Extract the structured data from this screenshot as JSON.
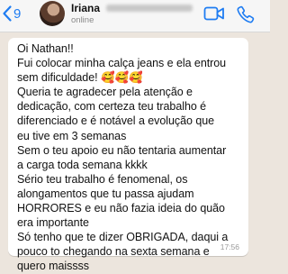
{
  "header": {
    "back_count": "9",
    "contact_name": "Iriana",
    "status": "online",
    "accent_color": "#1e7cf2",
    "icons": {
      "back": "chevron-left-icon",
      "video": "video-camera-icon",
      "phone": "phone-icon"
    }
  },
  "chat": {
    "background_color": "#ece5dd",
    "bubble_color": "#ffffff",
    "message": {
      "text": "Oi Nathan!!\nFui colocar minha calça jeans e ela entrou\nsem dificuldade! 🥰🥰🥰\nQueria te agradecer pela atenção e\ndedicação, com certeza teu trabalho é\ndiferenciado e é notável a evolução que\neu tive em 3 semanas\nSem o teu apoio eu não tentaria aumentar\na carga toda semana kkkk\nSério teu trabalho é fenomenal, os\nalongamentos que tu passa ajudam\nHORRORES e eu não fazia ideia do quão\nera importante\nSó tenho que te dizer OBRIGADA, daqui a\npouco to chegando na sexta semana e\nquero maissss",
      "time": "17:56"
    }
  }
}
